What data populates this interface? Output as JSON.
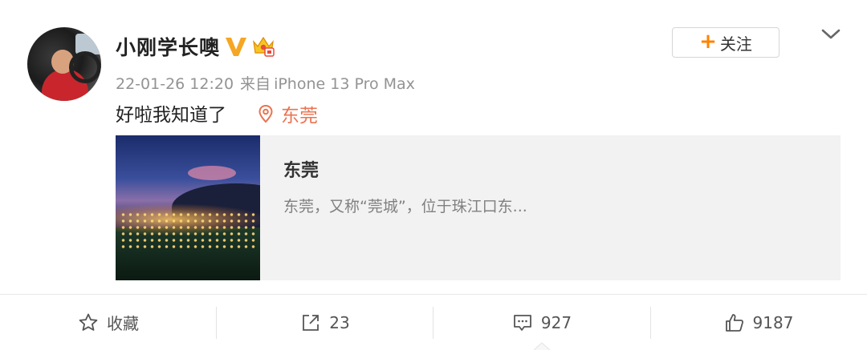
{
  "user": {
    "name": "小刚学长噢",
    "follow_label": "关注",
    "follow_plus": "+"
  },
  "meta": {
    "timestamp": "22-01-26 12:20",
    "source_prefix": "来自",
    "device": "iPhone 13 Pro Max"
  },
  "post": {
    "text": "好啦我知道了",
    "location": "东莞"
  },
  "card": {
    "title": "东莞",
    "description": "东莞，又称“莞城”，位于珠江口东..."
  },
  "toolbar": {
    "favorite_label": "收藏",
    "repost_count": "23",
    "comment_count": "927",
    "like_count": "9187"
  },
  "colors": {
    "accent_orange": "#ff8200",
    "location_color": "#eb7350",
    "verified_gold": "#f5a623",
    "text_gray": "#939393"
  },
  "icons": {
    "verified": "verified-v-icon",
    "vip": "vip-crown-icon",
    "location": "location-pin-icon",
    "favorite": "star-icon",
    "repost": "share-arrow-icon",
    "comment": "comment-bubble-icon",
    "like": "thumbs-up-icon",
    "more": "chevron-down-icon"
  }
}
